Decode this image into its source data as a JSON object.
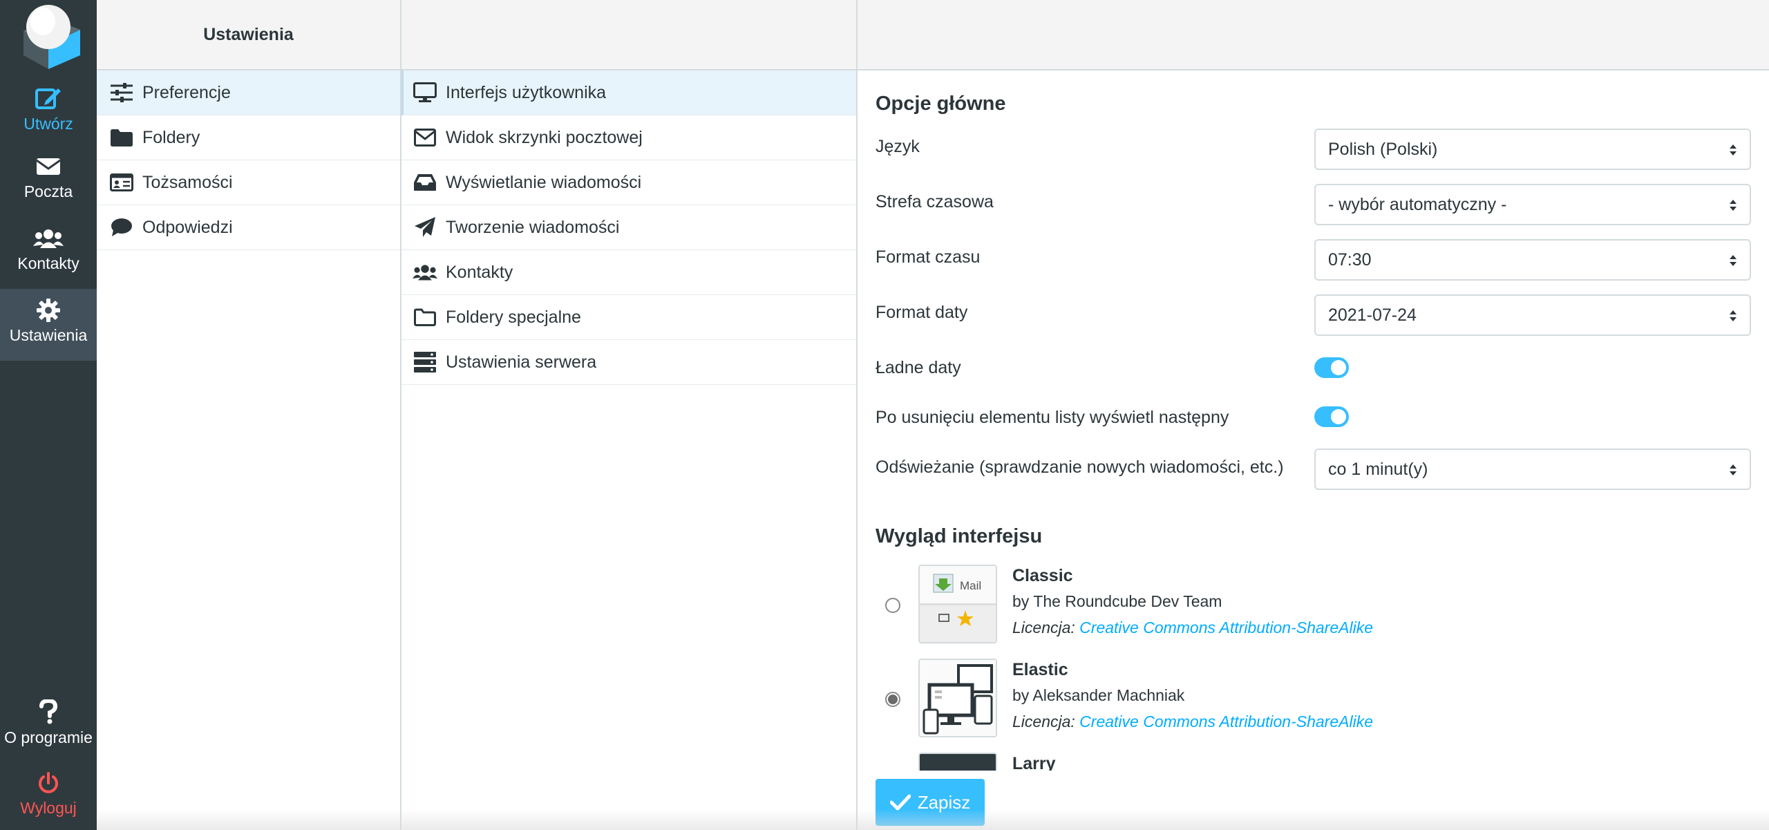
{
  "taskmenu": {
    "compose": "Utwórz",
    "mail": "Poczta",
    "contacts": "Kontakty",
    "settings": "Ustawienia",
    "about": "O programie",
    "logout": "Wyloguj"
  },
  "settings_nav": {
    "header": "Ustawienia",
    "items": [
      {
        "label": "Preferencje",
        "icon": "sliders-icon"
      },
      {
        "label": "Foldery",
        "icon": "folder-icon"
      },
      {
        "label": "Tożsamości",
        "icon": "id-card-icon"
      },
      {
        "label": "Odpowiedzi",
        "icon": "comment-icon"
      }
    ]
  },
  "sections_nav": {
    "items": [
      {
        "label": "Interfejs użytkownika",
        "icon": "monitor-icon"
      },
      {
        "label": "Widok skrzynki pocztowej",
        "icon": "envelope-icon"
      },
      {
        "label": "Wyświetlanie wiadomości",
        "icon": "inbox-icon"
      },
      {
        "label": "Tworzenie wiadomości",
        "icon": "paper-plane-icon"
      },
      {
        "label": "Kontakty",
        "icon": "users-icon"
      },
      {
        "label": "Foldery specjalne",
        "icon": "folder-open-icon"
      },
      {
        "label": "Ustawienia serwera",
        "icon": "server-icon"
      }
    ]
  },
  "main": {
    "section_main": "Opcje główne",
    "language_label": "Język",
    "language_value": "Polish (Polski)",
    "timezone_label": "Strefa czasowa",
    "timezone_value": "- wybór automatyczny -",
    "timeformat_label": "Format czasu",
    "timeformat_value": "07:30",
    "dateformat_label": "Format daty",
    "dateformat_value": "2021-07-24",
    "prettydate_label": "Ładne daty",
    "prettydate_on": true,
    "display_next_label": "Po usunięciu elementu listy wyświetl następny",
    "display_next_on": true,
    "refresh_label": "Odświeżanie (sprawdzanie nowych wiadomości, etc.)",
    "refresh_value": "co 1 minut(y)",
    "section_skin": "Wygląd interfejsu",
    "skins": [
      {
        "name": "Classic",
        "author": "by The Roundcube Dev Team",
        "license_label": "Licencja:",
        "license": "Creative Commons Attribution-ShareAlike",
        "selected": false
      },
      {
        "name": "Elastic",
        "author": "by Aleksander Machniak",
        "license_label": "Licencja:",
        "license": "Creative Commons Attribution-ShareAlike",
        "selected": true
      },
      {
        "name": "Larry",
        "author": "",
        "license_label": "",
        "license": "",
        "selected": false
      }
    ],
    "thumb_classic_text": "Mail",
    "save_label": "Zapisz"
  },
  "colors": {
    "accent": "#37beff",
    "sidebar_bg": "#2f3a3f",
    "logout": "#ff5552",
    "selected_row": "#e8f4fb"
  }
}
